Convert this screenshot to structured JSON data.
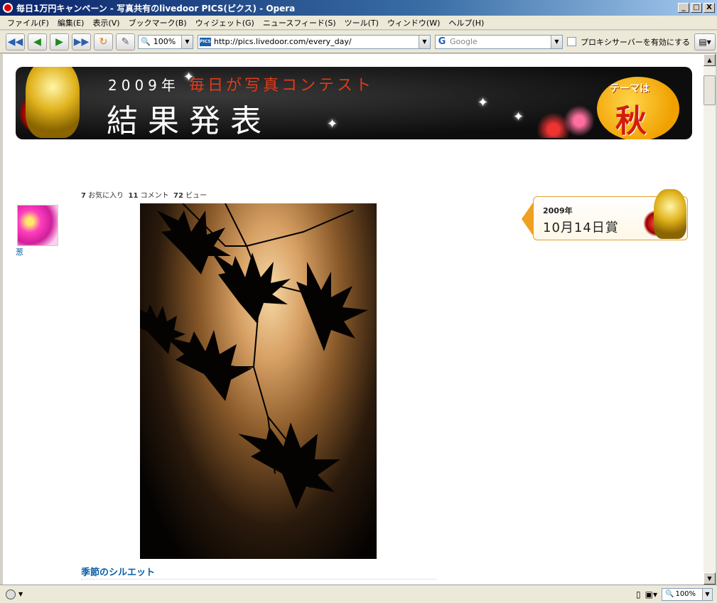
{
  "window": {
    "title": "毎日1万円キャンペーン - 写真共有のlivedoor PICS(ピクス) - Opera",
    "minimize": "_",
    "maximize": "□",
    "close": "X"
  },
  "menu": [
    "ファイル(F)",
    "編集(E)",
    "表示(V)",
    "ブックマーク(B)",
    "ウィジェット(G)",
    "ニュースフィード(S)",
    "ツール(T)",
    "ウィンドウ(W)",
    "ヘルプ(H)"
  ],
  "toolbar": {
    "zoom": "100%",
    "address": "http://pics.livedoor.com/every_day/",
    "search_placeholder": "Google",
    "proxy_label": "プロキシサーバーを有効にする"
  },
  "banner": {
    "year": "2009年",
    "contest": "毎日が写真コンテスト",
    "result": "結果発表",
    "theme_label": "テーマは",
    "theme": "秋"
  },
  "stats": {
    "favorites_count": "7",
    "favorites_label": "お気に入り",
    "comments_count": "11",
    "comments_label": "コメント",
    "views_count": "72",
    "views_label": "ビュー"
  },
  "user": {
    "name": "葱"
  },
  "photo": {
    "title": "季節のシルエット"
  },
  "award": {
    "year": "2009年",
    "date": "10月14日賞"
  },
  "statusbar": {
    "zoom": "100%"
  }
}
